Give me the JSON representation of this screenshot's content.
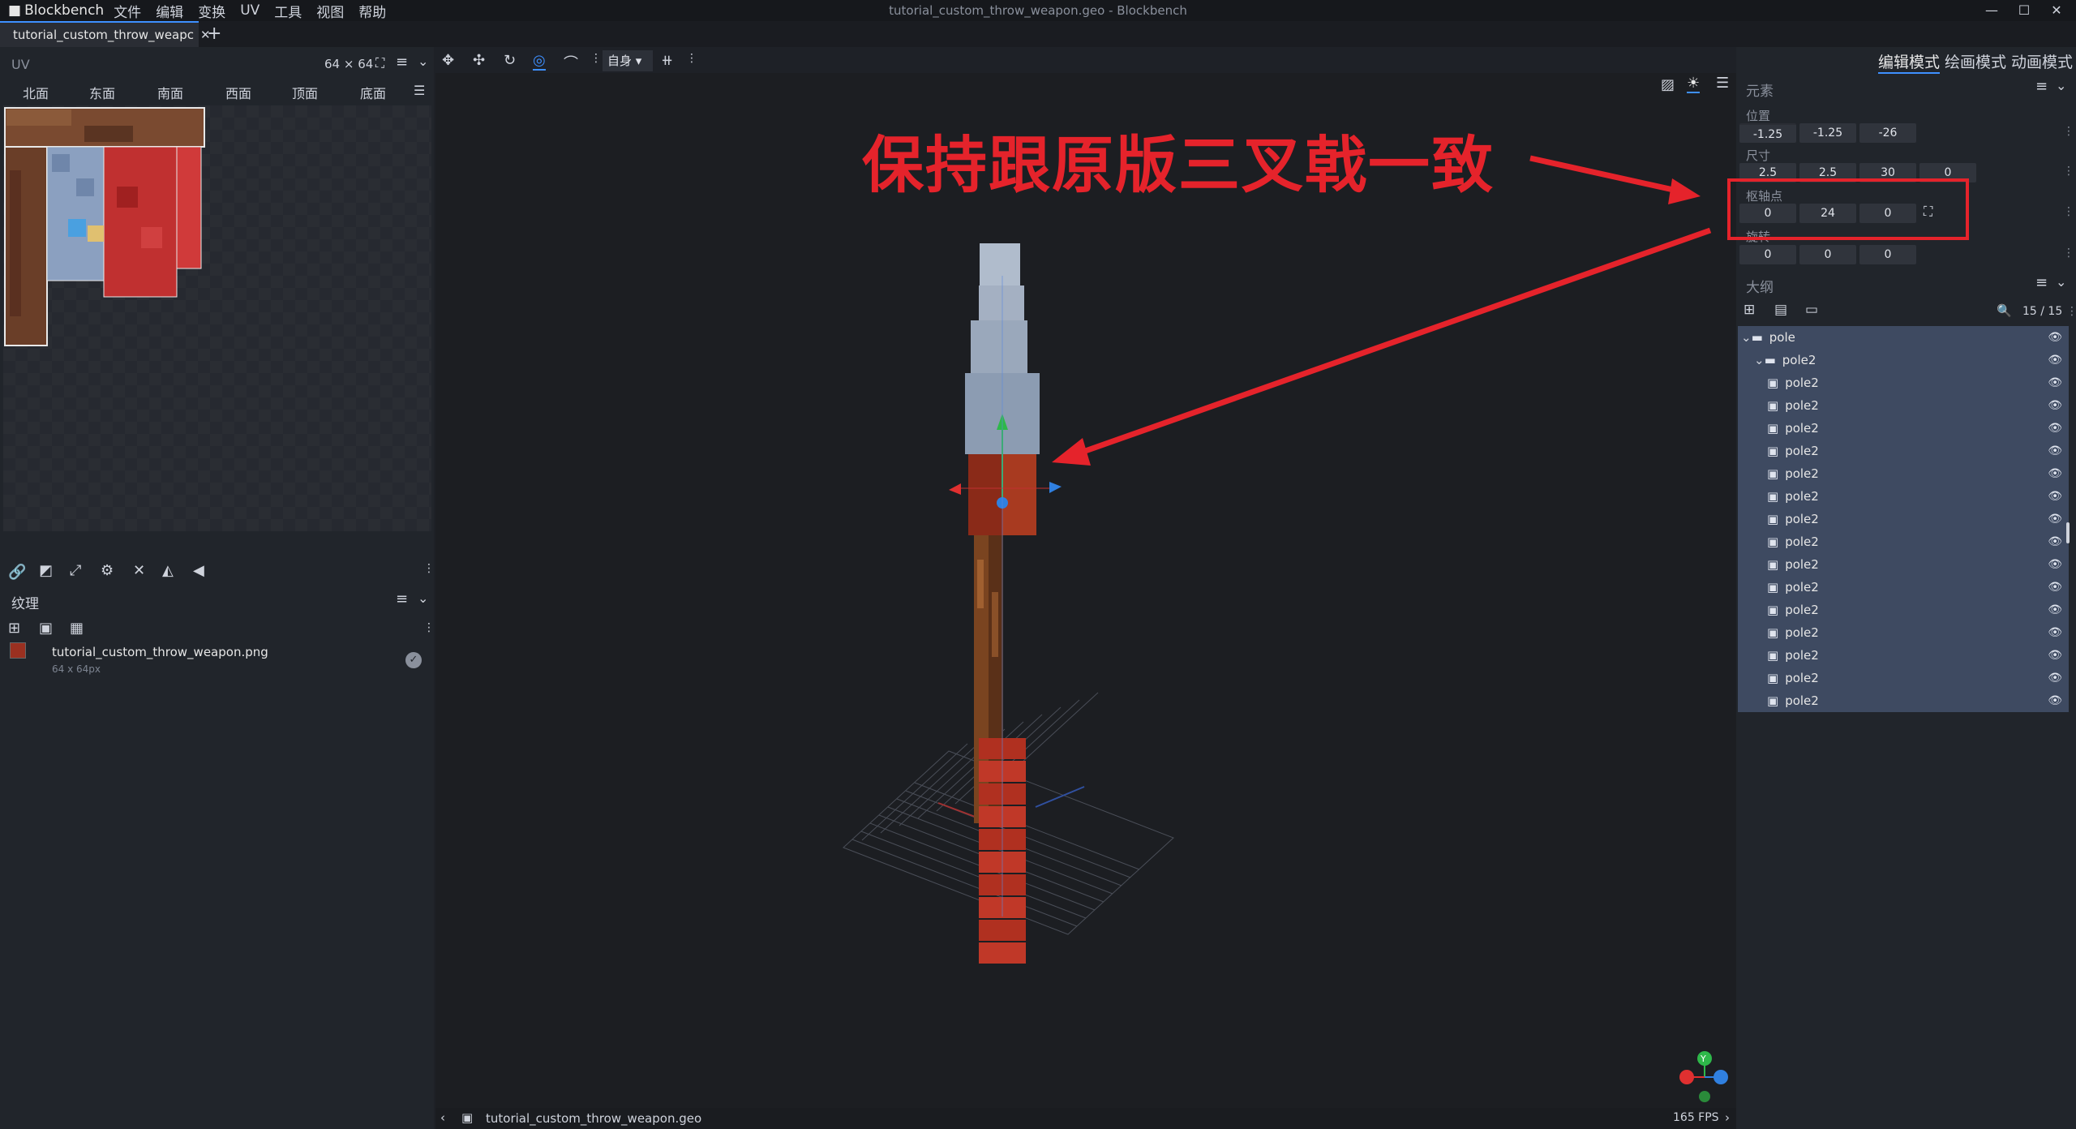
{
  "titlebar": {
    "app_name": "Blockbench",
    "menu": [
      "文件",
      "编辑",
      "变换",
      "UV",
      "工具",
      "视图",
      "帮助"
    ],
    "window_title": "tutorial_custom_throw_weapon.geo - Blockbench"
  },
  "tab": {
    "label": "tutorial_custom_throw_weapc",
    "close": "✕",
    "new": "+"
  },
  "uv_panel": {
    "title": "UV",
    "size": "64 × 64",
    "faces": [
      "北面",
      "东面",
      "南面",
      "西面",
      "顶面",
      "底面"
    ]
  },
  "texture_panel": {
    "title": "纹理",
    "file_name": "tutorial_custom_throw_weapon.png",
    "file_size": "64 x 64px"
  },
  "viewport": {
    "mode_select": "自身",
    "annotation": "保持跟原版三叉戟一致"
  },
  "status_bar": {
    "file": "tutorial_custom_throw_weapon.geo",
    "fps": "165 FPS"
  },
  "modes": [
    "编辑模式",
    "绘画模式",
    "动画模式"
  ],
  "element_panel": {
    "title": "元素",
    "position_label": "位置",
    "position": [
      "-1.25",
      "-1.25",
      "-26"
    ],
    "size_label": "尺寸",
    "size": [
      "2.5",
      "2.5",
      "30",
      "0"
    ],
    "pivot_label": "枢轴点",
    "pivot": [
      "0",
      "24",
      "0"
    ],
    "rotation_label": "旋转",
    "rotation": [
      "0",
      "0",
      "0"
    ]
  },
  "outline_panel": {
    "title": "大纲",
    "count": "15 / 15",
    "items": [
      {
        "name": "pole",
        "type": "group",
        "depth": 0
      },
      {
        "name": "pole2",
        "type": "group",
        "depth": 1
      },
      {
        "name": "pole2",
        "type": "cube",
        "depth": 2
      },
      {
        "name": "pole2",
        "type": "cube",
        "depth": 2
      },
      {
        "name": "pole2",
        "type": "cube",
        "depth": 2
      },
      {
        "name": "pole2",
        "type": "cube",
        "depth": 2
      },
      {
        "name": "pole2",
        "type": "cube",
        "depth": 2
      },
      {
        "name": "pole2",
        "type": "cube",
        "depth": 2
      },
      {
        "name": "pole2",
        "type": "cube",
        "depth": 2
      },
      {
        "name": "pole2",
        "type": "cube",
        "depth": 2
      },
      {
        "name": "pole2",
        "type": "cube",
        "depth": 2
      },
      {
        "name": "pole2",
        "type": "cube",
        "depth": 2
      },
      {
        "name": "pole2",
        "type": "cube",
        "depth": 2
      },
      {
        "name": "pole2",
        "type": "cube",
        "depth": 2
      },
      {
        "name": "pole2",
        "type": "cube",
        "depth": 2
      },
      {
        "name": "pole2",
        "type": "cube",
        "depth": 2
      },
      {
        "name": "pole2",
        "type": "cube",
        "depth": 2
      }
    ]
  },
  "gizmo": {
    "y_label": "Y"
  },
  "colors": {
    "accent": "#3e90ff",
    "annotation": "#e5232b",
    "outline_bg": "#3e4a61"
  }
}
